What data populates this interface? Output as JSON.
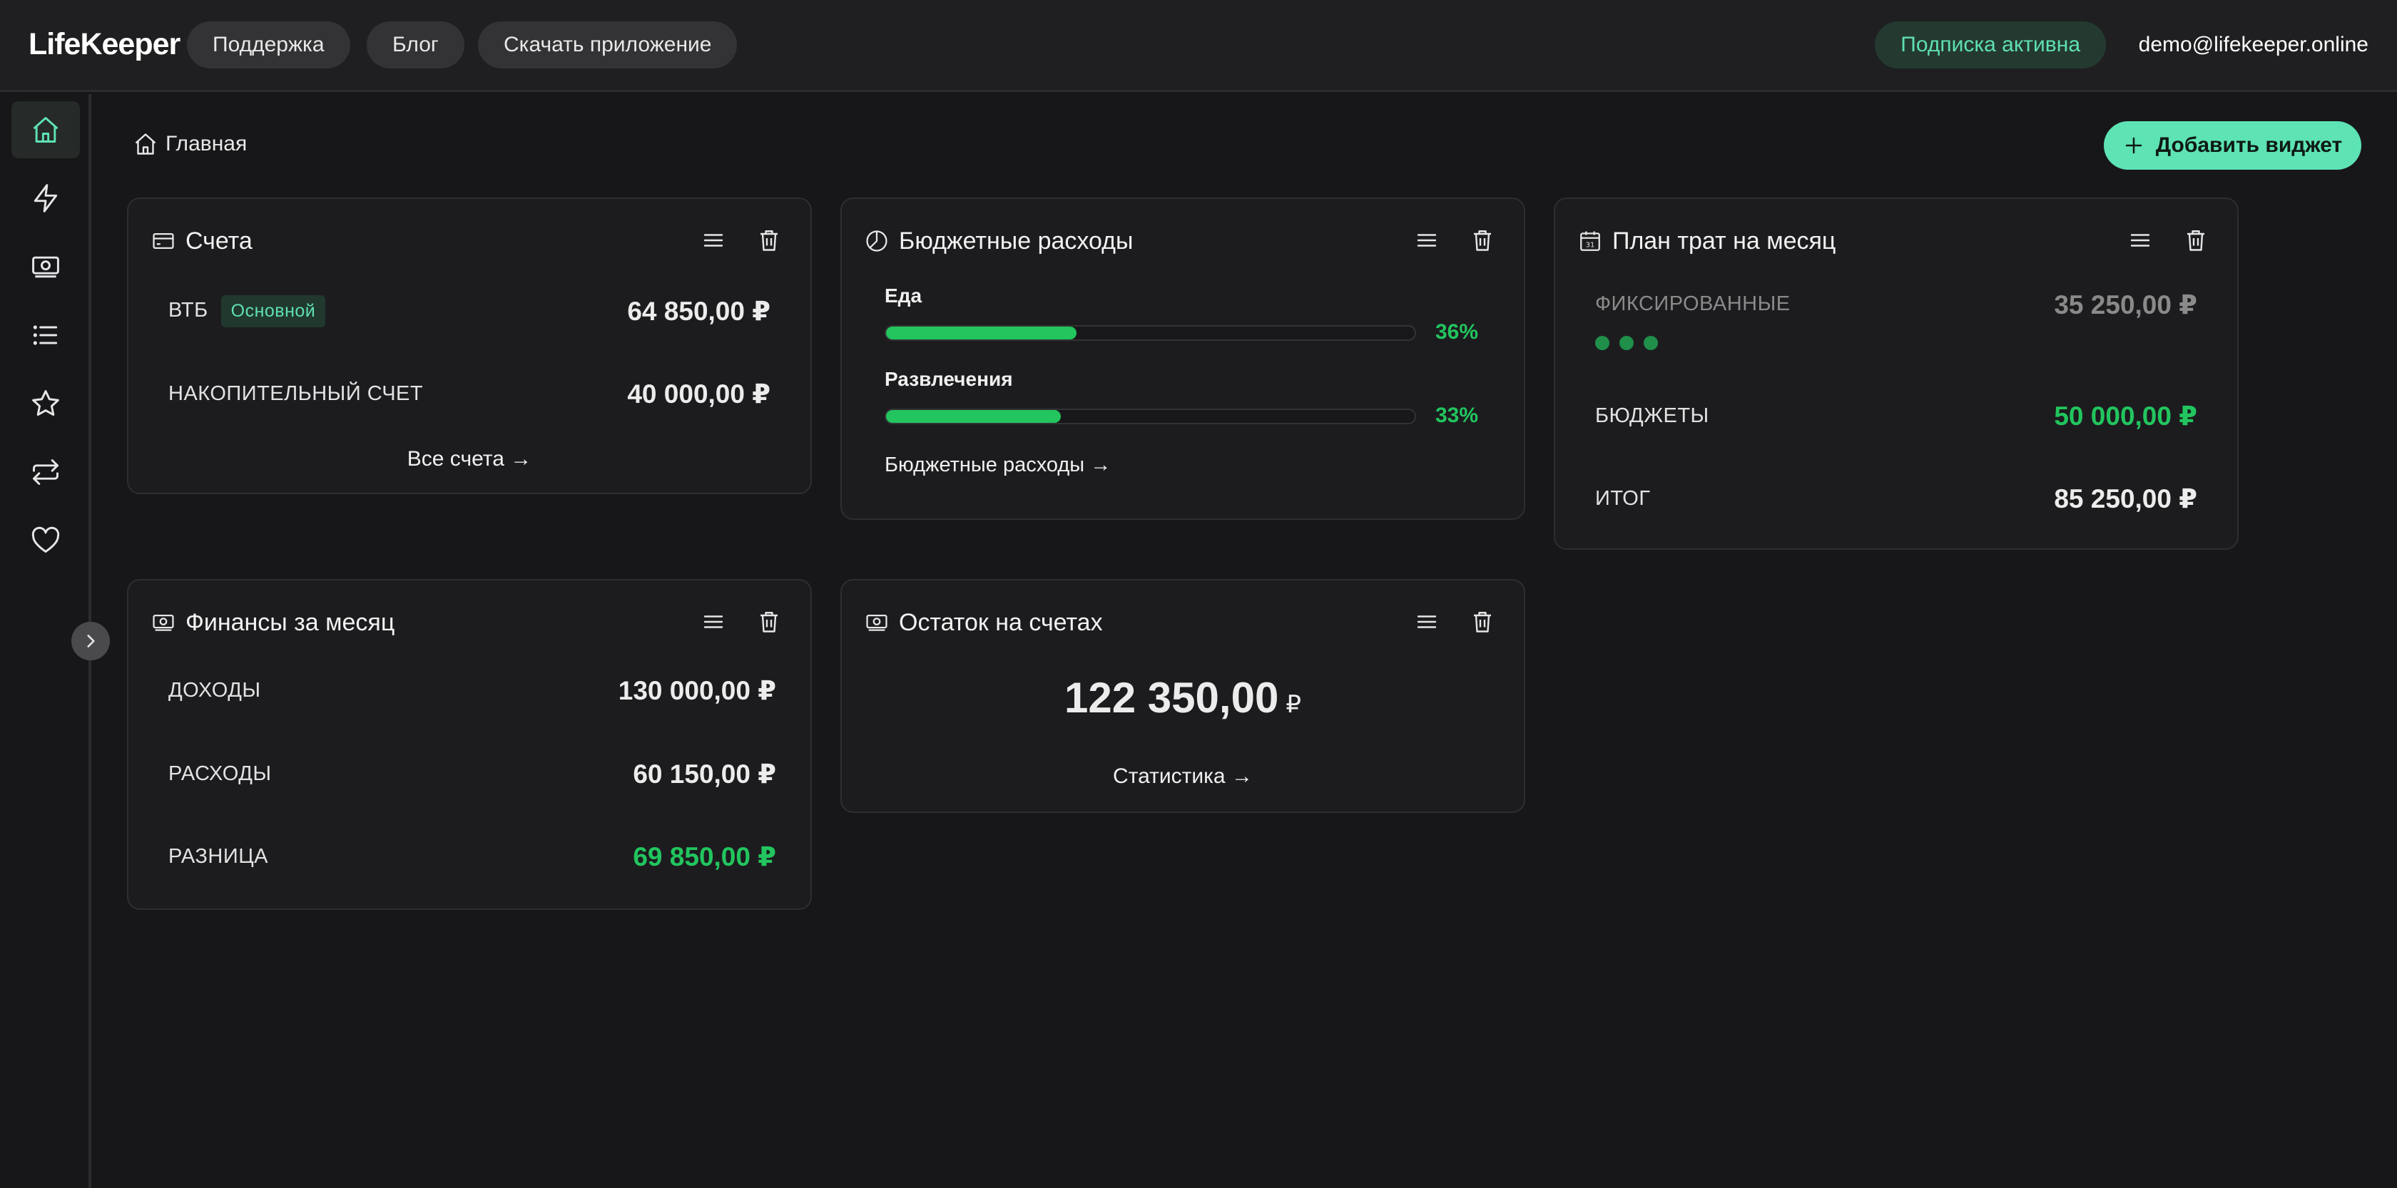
{
  "app": {
    "name": "LifeKeeper"
  },
  "topbar": {
    "nav": [
      "Поддержка",
      "Блог",
      "Скачать приложение"
    ],
    "subscription": "Подписка активна",
    "user_email": "demo@lifekeeper.online"
  },
  "breadcrumb": {
    "label": "Главная"
  },
  "add_widget": {
    "label": "Добавить виджет"
  },
  "colors": {
    "accent": "#5ee3b4",
    "positive": "#22c55e",
    "background": "#17171a",
    "card": "#1c1c1f"
  },
  "widgets": {
    "accounts": {
      "title": "Счета",
      "items": [
        {
          "name": "ВТБ",
          "badge": "Основной",
          "amount": "64 850,00 ₽"
        },
        {
          "name": "НАКОПИТЕЛЬНЫЙ СЧЕТ",
          "amount": "40 000,00 ₽"
        }
      ],
      "link": "Все счета →"
    },
    "budgets": {
      "title": "Бюджетные расходы",
      "items": [
        {
          "name": "Еда",
          "percent": 36,
          "percent_label": "36%"
        },
        {
          "name": "Развлечения",
          "percent": 33,
          "percent_label": "33%"
        }
      ],
      "link": "Бюджетные расходы →"
    },
    "plan": {
      "title": "План трат на месяц",
      "fixed_label": "ФИКСИРОВАННЫЕ",
      "fixed_amount": "35 250,00 ₽",
      "budgets_label": "БЮДЖЕТЫ",
      "budgets_amount": "50 000,00 ₽",
      "total_label": "ИТОГ",
      "total_amount": "85 250,00 ₽"
    },
    "finance": {
      "title": "Финансы за месяц",
      "income_label": "ДОХОДЫ",
      "income_amount": "130 000,00 ₽",
      "expense_label": "РАСХОДЫ",
      "expense_amount": "60 150,00 ₽",
      "diff_label": "РАЗНИЦА",
      "diff_amount": "69 850,00 ₽"
    },
    "balance": {
      "title": "Остаток на счетах",
      "amount": "122 350,00",
      "currency": "₽",
      "link": "Статистика →"
    }
  },
  "sidebar": {
    "icons": [
      "home-icon",
      "lightning-icon",
      "money-icon",
      "list-icon",
      "star-icon",
      "repeat-icon",
      "heart-icon"
    ]
  }
}
